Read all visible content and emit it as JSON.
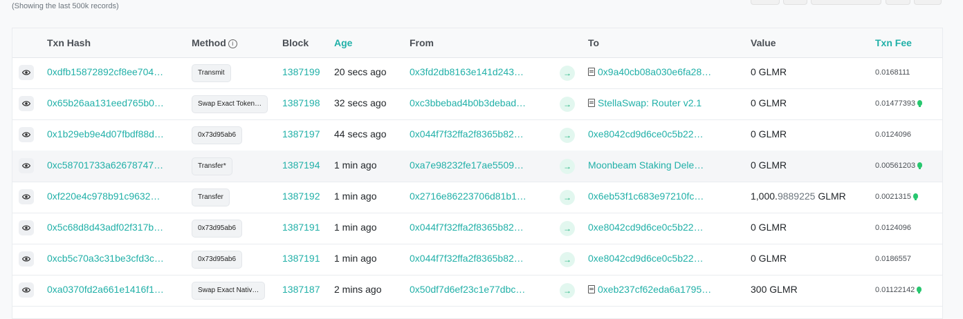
{
  "note": "(Showing the last 500k records)",
  "columns": {
    "txn_hash": "Txn Hash",
    "method": "Method",
    "block": "Block",
    "age": "Age",
    "from": "From",
    "to": "To",
    "value": "Value",
    "txn_fee": "Txn Fee"
  },
  "colors": {
    "link": "#21b0a8",
    "arrow_bg": "#e2f7ef",
    "arrow": "#15b079",
    "bulb": "#28c76f"
  },
  "rows": [
    {
      "hash": "0xdfb15872892cf8ee704…",
      "method": "Transmit",
      "block": "1387199",
      "age": "20 secs ago",
      "from": "0x3fd2db8163e141d243…",
      "to": "0x9a40cb08a030e6fa28…",
      "to_contract": true,
      "value_main": "0 GLMR",
      "value_dim": "",
      "value_unit": "",
      "fee": "0.0168111",
      "fee_bulb": false
    },
    {
      "hash": "0x65b26aa131eed765b0…",
      "method": "Swap Exact Token…",
      "block": "1387198",
      "age": "32 secs ago",
      "from": "0xc3bbebad4b0b3debad…",
      "to": "StellaSwap: Router v2.1",
      "to_contract": true,
      "value_main": "0 GLMR",
      "value_dim": "",
      "value_unit": "",
      "fee": "0.01477393",
      "fee_bulb": true
    },
    {
      "hash": "0x1b29eb9e4d07fbdf88d…",
      "method": "0x73d95ab6",
      "block": "1387197",
      "age": "44 secs ago",
      "from": "0x044f7f32ffa2f8365b82…",
      "to": "0xe8042cd9d6ce0c5b22…",
      "to_contract": false,
      "value_main": "0 GLMR",
      "value_dim": "",
      "value_unit": "",
      "fee": "0.0124096",
      "fee_bulb": false
    },
    {
      "hash": "0xc58701733a62678747…",
      "method": "Transfer*",
      "block": "1387194",
      "age": "1 min ago",
      "from": "0xa7e98232fe17ae5509…",
      "to": "Moonbeam Staking Dele…",
      "to_contract": false,
      "value_main": "0 GLMR",
      "value_dim": "",
      "value_unit": "",
      "fee": "0.00561203",
      "fee_bulb": true,
      "highlight": true
    },
    {
      "hash": "0xf220e4c978b91c9632…",
      "method": "Transfer",
      "block": "1387192",
      "age": "1 min ago",
      "from": "0x2716e86223706d81b1…",
      "to": "0x6eb53f1c683e97210fc…",
      "to_contract": false,
      "value_main": "1,000.",
      "value_dim": "9889225",
      "value_unit": " GLMR",
      "fee": "0.0021315",
      "fee_bulb": true
    },
    {
      "hash": "0x5c68d8d43adf02f317b…",
      "method": "0x73d95ab6",
      "block": "1387191",
      "age": "1 min ago",
      "from": "0x044f7f32ffa2f8365b82…",
      "to": "0xe8042cd9d6ce0c5b22…",
      "to_contract": false,
      "value_main": "0 GLMR",
      "value_dim": "",
      "value_unit": "",
      "fee": "0.0124096",
      "fee_bulb": false
    },
    {
      "hash": "0xcb5c70a3c31be3cfd3c…",
      "method": "0x73d95ab6",
      "block": "1387191",
      "age": "1 min ago",
      "from": "0x044f7f32ffa2f8365b82…",
      "to": "0xe8042cd9d6ce0c5b22…",
      "to_contract": false,
      "value_main": "0 GLMR",
      "value_dim": "",
      "value_unit": "",
      "fee": "0.0186557",
      "fee_bulb": false
    },
    {
      "hash": "0xa0370fd2a661e1416f1…",
      "method": "Swap Exact Nativ…",
      "block": "1387187",
      "age": "2 mins ago",
      "from": "0x50df7d6ef23c1e77dbc…",
      "to": "0xeb237cf62eda6a1795…",
      "to_contract": true,
      "value_main": "300 GLMR",
      "value_dim": "",
      "value_unit": "",
      "fee": "0.01122142",
      "fee_bulb": true
    }
  ]
}
